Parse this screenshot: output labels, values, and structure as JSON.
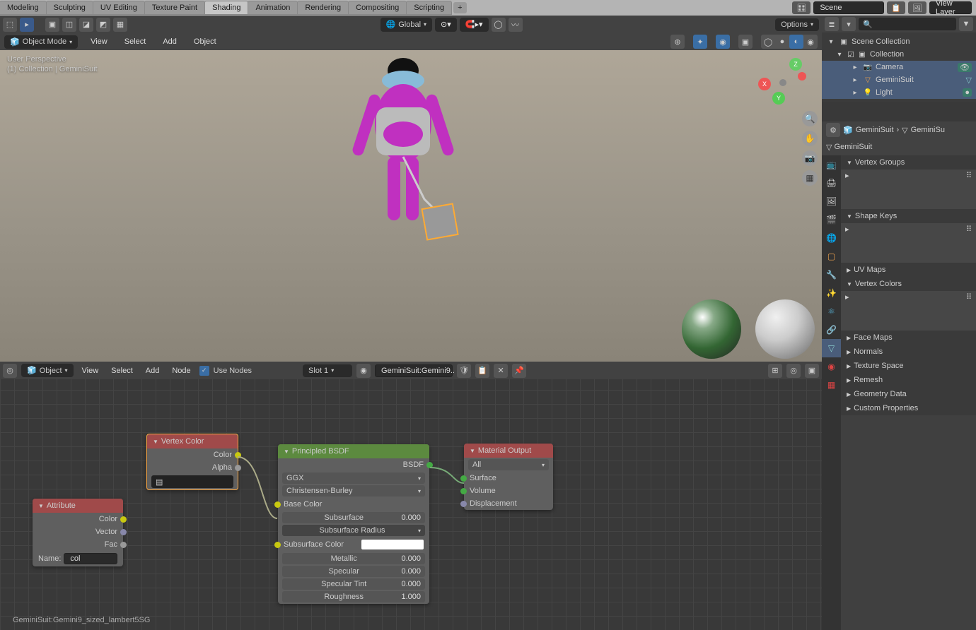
{
  "topbar": {
    "tabs": [
      "Modeling",
      "Sculpting",
      "UV Editing",
      "Texture Paint",
      "Shading",
      "Animation",
      "Rendering",
      "Compositing",
      "Scripting"
    ],
    "active_tab": "Shading",
    "scene_field": "Scene",
    "viewlayer_field": "View Layer"
  },
  "viewport": {
    "mode": "Object Mode",
    "menus": [
      "View",
      "Select",
      "Add",
      "Object"
    ],
    "orientation": "Global",
    "options_label": "Options",
    "info_line1": "User Perspective",
    "info_line2": "(1) Collection | GeminiSuit"
  },
  "outliner": {
    "root": "Scene Collection",
    "collection": "Collection",
    "items": [
      "Camera",
      "GeminiSuit",
      "Light"
    ]
  },
  "props": {
    "breadcrumb1": "GeminiSuit",
    "breadcrumb2": "GeminiSu",
    "object_name": "GeminiSuit",
    "panels": [
      "Vertex Groups",
      "Shape Keys",
      "UV Maps",
      "Vertex Colors",
      "Face Maps",
      "Normals",
      "Texture Space",
      "Remesh",
      "Geometry Data",
      "Custom Properties"
    ]
  },
  "node_editor": {
    "mode": "Object",
    "menus": [
      "View",
      "Select",
      "Add",
      "Node"
    ],
    "use_nodes": "Use Nodes",
    "slot": "Slot 1",
    "material": "GeminiSuit:Gemini9..",
    "status": "GeminiSuit:Gemini9_sized_lambert5SG"
  },
  "nodes": {
    "attribute": {
      "title": "Attribute",
      "outputs": [
        "Color",
        "Vector",
        "Fac"
      ],
      "name_label": "Name:",
      "name_value": "col"
    },
    "vertex_color": {
      "title": "Vertex Color",
      "outputs": [
        "Color",
        "Alpha"
      ],
      "field": ""
    },
    "principled": {
      "title": "Principled BSDF",
      "bsdf": "BSDF",
      "dist": "GGX",
      "sss_method": "Christensen-Burley",
      "rows": [
        {
          "label": "Base Color",
          "val": ""
        },
        {
          "label": "Subsurface",
          "val": "0.000"
        },
        {
          "label": "Subsurface Radius",
          "val": ""
        },
        {
          "label": "Subsurface Color",
          "val": ""
        },
        {
          "label": "Metallic",
          "val": "0.000"
        },
        {
          "label": "Specular",
          "val": "0.000"
        },
        {
          "label": "Specular Tint",
          "val": "0.000"
        },
        {
          "label": "Roughness",
          "val": "1.000"
        }
      ]
    },
    "material_output": {
      "title": "Material Output",
      "target": "All",
      "inputs": [
        "Surface",
        "Volume",
        "Displacement"
      ]
    }
  }
}
